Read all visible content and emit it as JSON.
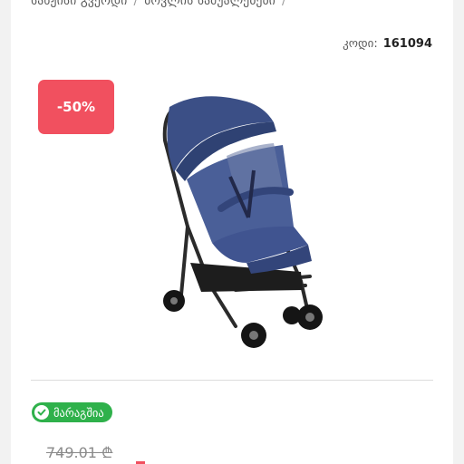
{
  "breadcrumb": {
    "items": [
      "სახჟისი გვერდი",
      "ბოვლის სამუალებები"
    ],
    "separator": "/"
  },
  "product": {
    "code_label": "კოდი:",
    "code_value": "161094",
    "discount_badge": "-50%",
    "image_icon": "stroller-image",
    "stock_label": "მარაგშია",
    "old_price": "749.01 ₾"
  },
  "colors": {
    "discount": "#f1505f",
    "in_stock": "#2fb14b",
    "stroller_body": "#3b4f86"
  }
}
